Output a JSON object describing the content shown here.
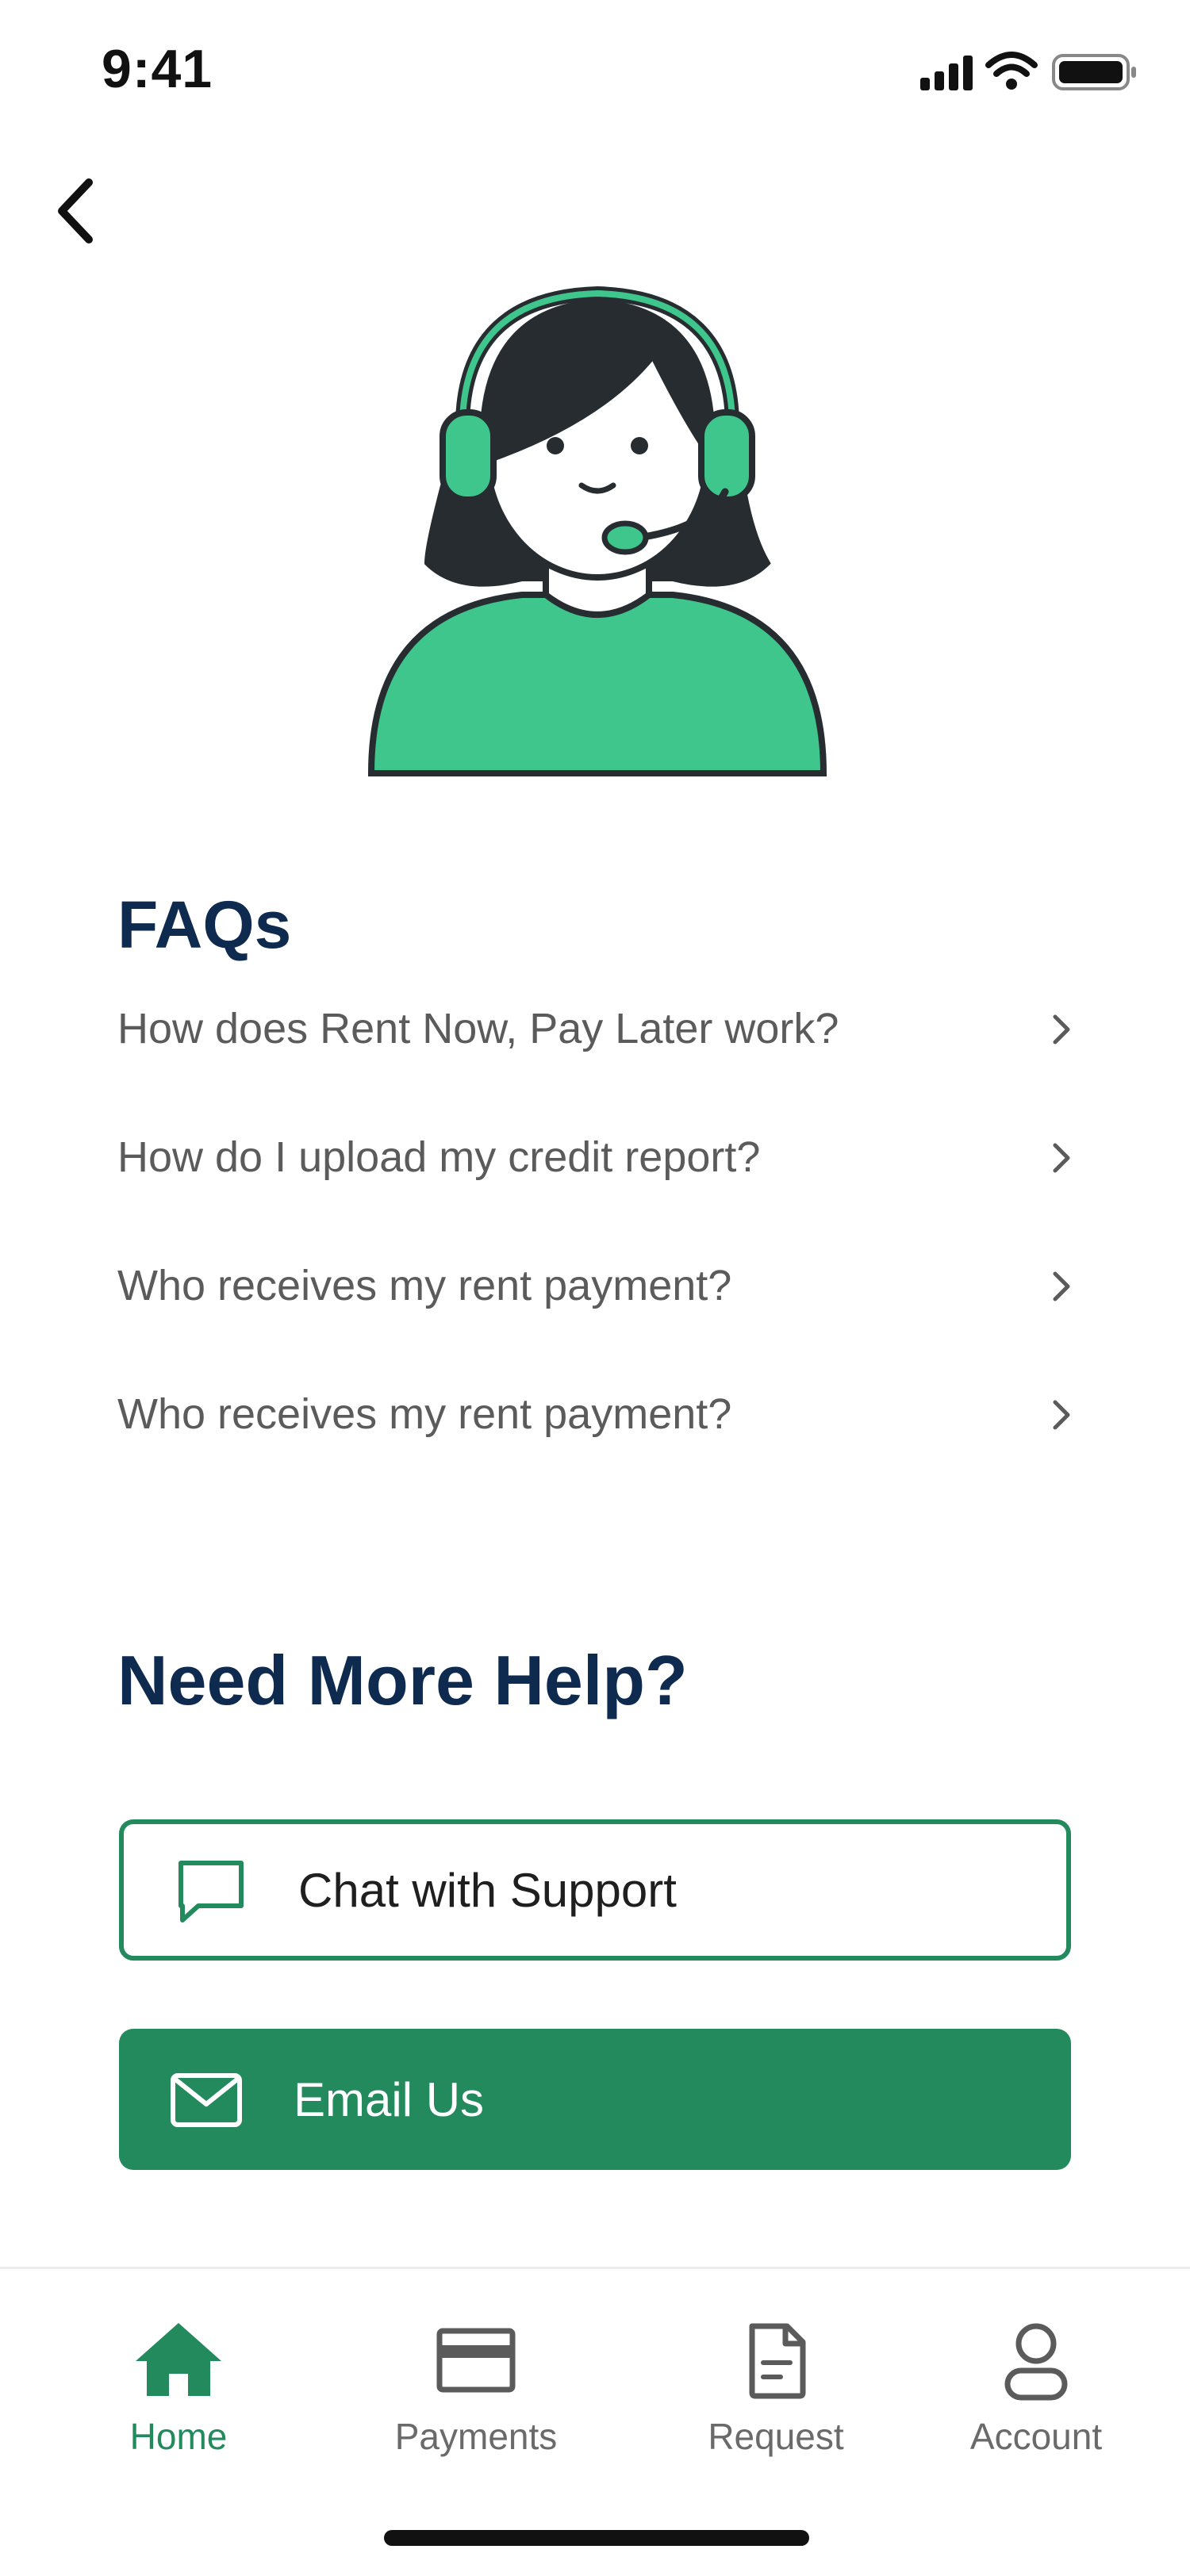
{
  "status_bar": {
    "time": "9:41"
  },
  "navigation": {
    "back_icon": "chevron-left-icon"
  },
  "hero": {
    "icon": "support-agent-illustration",
    "colors": {
      "accent": "#3ec68d",
      "outline": "#262c30",
      "skin": "#ffffff"
    }
  },
  "faq": {
    "title": "FAQs",
    "items": [
      {
        "question": "How does Rent Now, Pay Later work?"
      },
      {
        "question": "How do I upload my credit report?"
      },
      {
        "question": "Who receives my rent payment?"
      },
      {
        "question": "Who receives my rent payment?"
      }
    ]
  },
  "help": {
    "title": "Need More Help?",
    "chat_button": {
      "label": "Chat with Support",
      "icon": "chat-bubble-icon"
    },
    "email_button": {
      "label": "Email Us",
      "icon": "envelope-icon"
    }
  },
  "tabbar": {
    "active": "Home",
    "tabs": [
      {
        "label": "Home",
        "icon": "home-icon"
      },
      {
        "label": "Payments",
        "icon": "credit-card-icon"
      },
      {
        "label": "Request",
        "icon": "document-icon"
      },
      {
        "label": "Account",
        "icon": "person-icon"
      }
    ]
  },
  "colors": {
    "primary": "#228a5c",
    "heading": "#0e2a4f",
    "body_text": "#5b5b5b",
    "inactive_tab": "#6a6a6a"
  }
}
